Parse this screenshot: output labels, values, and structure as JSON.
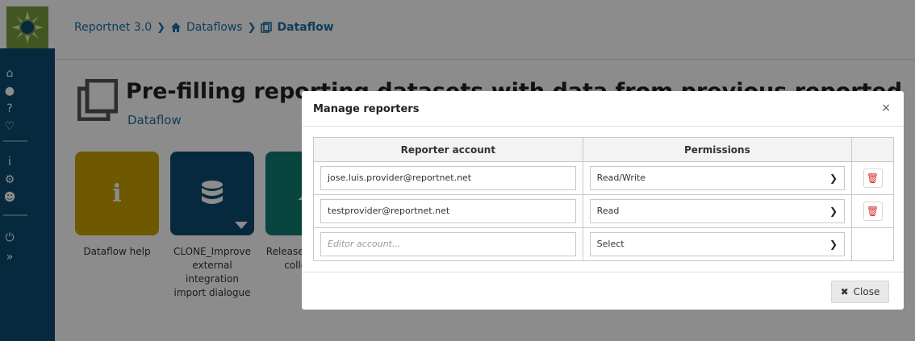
{
  "breadcrumb": {
    "root": "Reportnet 3.0",
    "dataflows": "Dataflows",
    "current": "Dataflow",
    "separator": "❯"
  },
  "page": {
    "title": "Pre-filling reporting datasets with data from previous reported",
    "subtitle": "Dataflow"
  },
  "tiles": [
    {
      "label": "Dataflow help",
      "color": "#c9a100",
      "icon": "info-icon"
    },
    {
      "label": "CLONE_Improve external integration import dialogue",
      "color": "#0b4c71",
      "icon": "database-icon"
    },
    {
      "label": "Release dataflow collection",
      "color": "#0f7f72",
      "icon": "cloud-icon"
    }
  ],
  "dialog": {
    "title": "Manage reporters",
    "close_x": "×",
    "headers": {
      "account": "Reporter account",
      "permissions": "Permissions"
    },
    "rows": [
      {
        "account": "jose.luis.provider@reportnet.net",
        "permission": "Read/Write"
      },
      {
        "account": "testprovider@reportnet.net",
        "permission": "Read"
      }
    ],
    "new_row": {
      "placeholder": "Editor account...",
      "permission": "Select"
    },
    "close_label": "Close"
  },
  "colors": {
    "brand_blue": "#0b4c71",
    "link_blue": "#1d6fa8",
    "delete_red": "#d32f2f"
  }
}
